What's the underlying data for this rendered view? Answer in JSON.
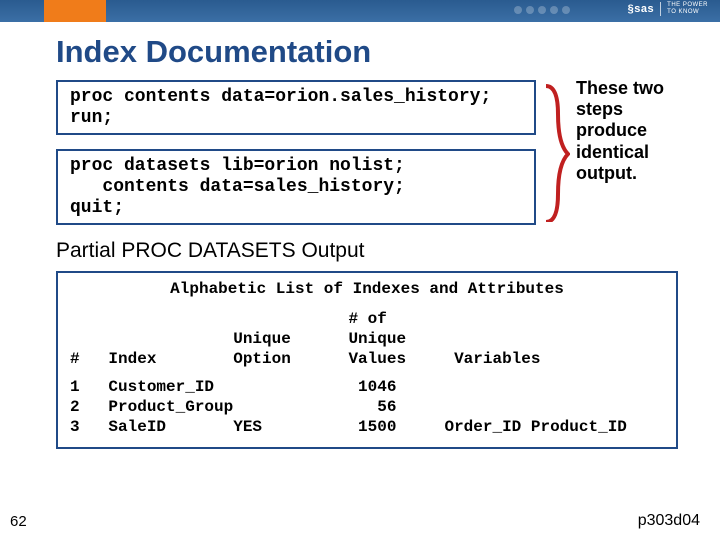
{
  "logo": {
    "brand": "§sas",
    "tagline1": "THE POWER",
    "tagline2": "TO KNOW"
  },
  "title": "Index Documentation",
  "code1": "proc contents data=orion.sales_history;\nrun;",
  "code2": "proc datasets lib=orion nolist;\n   contents data=sales_history;\nquit;",
  "sidenote": "These two steps produce identical output.",
  "partial": "Partial PROC DATASETS Output",
  "output": {
    "title": "Alphabetic List of Indexes and Attributes",
    "h1a": "                             # of",
    "h1b": "                 Unique      Unique",
    "h1c": "#   Index        Option      Values     Variables",
    "r1": "1   Customer_ID               1046",
    "r2": "2   Product_Group               56",
    "r3": "3   SaleID       YES          1500     Order_ID Product_ID"
  },
  "page": "62",
  "ref": "p303d04"
}
